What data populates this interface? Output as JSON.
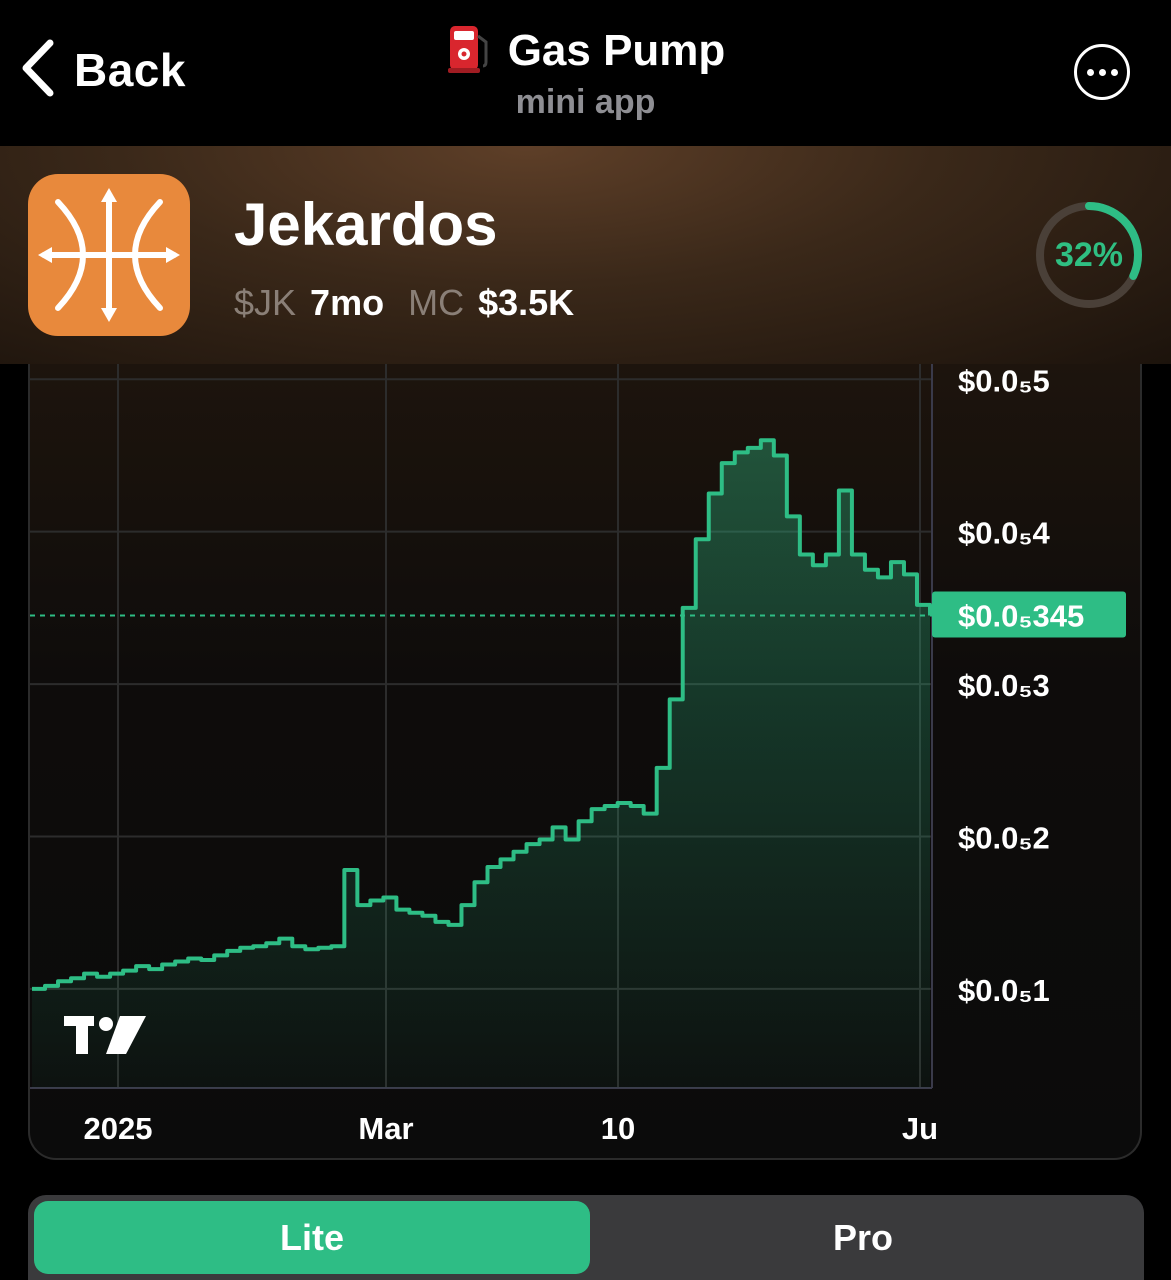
{
  "topbar": {
    "back_label": "Back",
    "title": "Gas Pump",
    "subtitle": "mini app"
  },
  "token": {
    "name": "Jekardos",
    "ticker": "$JK",
    "age": "7mo",
    "mc_label": "MC",
    "mc_value": "$3.5K",
    "progress_label": "32%",
    "progress": 0.32
  },
  "colors": {
    "accent": "#2ebd85",
    "logo_bg": "#e8893c"
  },
  "chart_data": {
    "type": "area",
    "y_tick_labels": [
      "$0.0₅5",
      "$0.0₅4",
      "$0.0₅3",
      "$0.0₅2",
      "$0.0₅1"
    ],
    "y_tick_values": [
      5,
      4,
      3,
      2,
      1
    ],
    "x_tick_labels": [
      "2025",
      "Mar",
      "10",
      "Ju"
    ],
    "current_price_label": "$0.0₅345",
    "current_price": 3.45,
    "ylim": [
      0.35,
      5.1
    ],
    "series": [
      {
        "values": [
          1.0,
          1.02,
          1.05,
          1.07,
          1.1,
          1.08,
          1.1,
          1.12,
          1.15,
          1.13,
          1.16,
          1.18,
          1.2,
          1.19,
          1.22,
          1.25,
          1.27,
          1.28,
          1.3,
          1.33,
          1.28,
          1.26,
          1.27,
          1.28,
          1.78,
          1.55,
          1.58,
          1.6,
          1.52,
          1.5,
          1.48,
          1.44,
          1.42,
          1.55,
          1.7,
          1.8,
          1.85,
          1.9,
          1.95,
          1.98,
          2.06,
          1.98,
          2.1,
          2.18,
          2.2,
          2.22,
          2.2,
          2.15,
          2.45,
          2.9,
          3.5,
          3.95,
          4.25,
          4.45,
          4.52,
          4.55,
          4.6,
          4.5,
          4.1,
          3.85,
          3.78,
          3.85,
          4.27,
          3.85,
          3.75,
          3.7,
          3.8,
          3.72,
          3.52,
          3.45
        ]
      }
    ]
  }
}
